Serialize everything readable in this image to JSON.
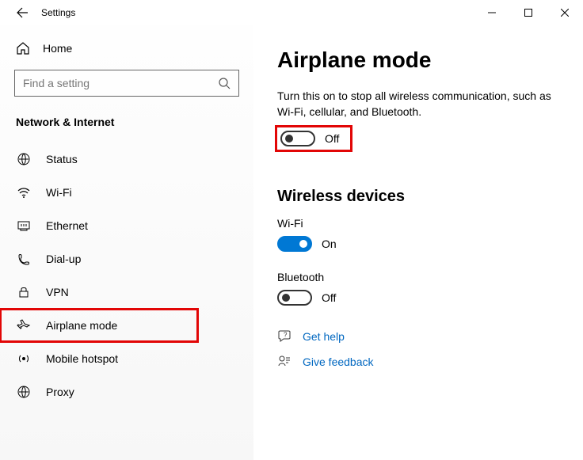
{
  "titlebar": {
    "title": "Settings"
  },
  "sidebar": {
    "home_label": "Home",
    "search_placeholder": "Find a setting",
    "section_label": "Network & Internet",
    "items": [
      {
        "label": "Status"
      },
      {
        "label": "Wi-Fi"
      },
      {
        "label": "Ethernet"
      },
      {
        "label": "Dial-up"
      },
      {
        "label": "VPN"
      },
      {
        "label": "Airplane mode"
      },
      {
        "label": "Mobile hotspot"
      },
      {
        "label": "Proxy"
      }
    ]
  },
  "main": {
    "title": "Airplane mode",
    "description": "Turn this on to stop all wireless communication, such as Wi-Fi, cellular, and Bluetooth.",
    "airplane_toggle_label": "Off",
    "wireless_heading": "Wireless devices",
    "wifi_label": "Wi-Fi",
    "wifi_toggle_label": "On",
    "bt_label": "Bluetooth",
    "bt_toggle_label": "Off",
    "help_label": "Get help",
    "feedback_label": "Give feedback"
  }
}
